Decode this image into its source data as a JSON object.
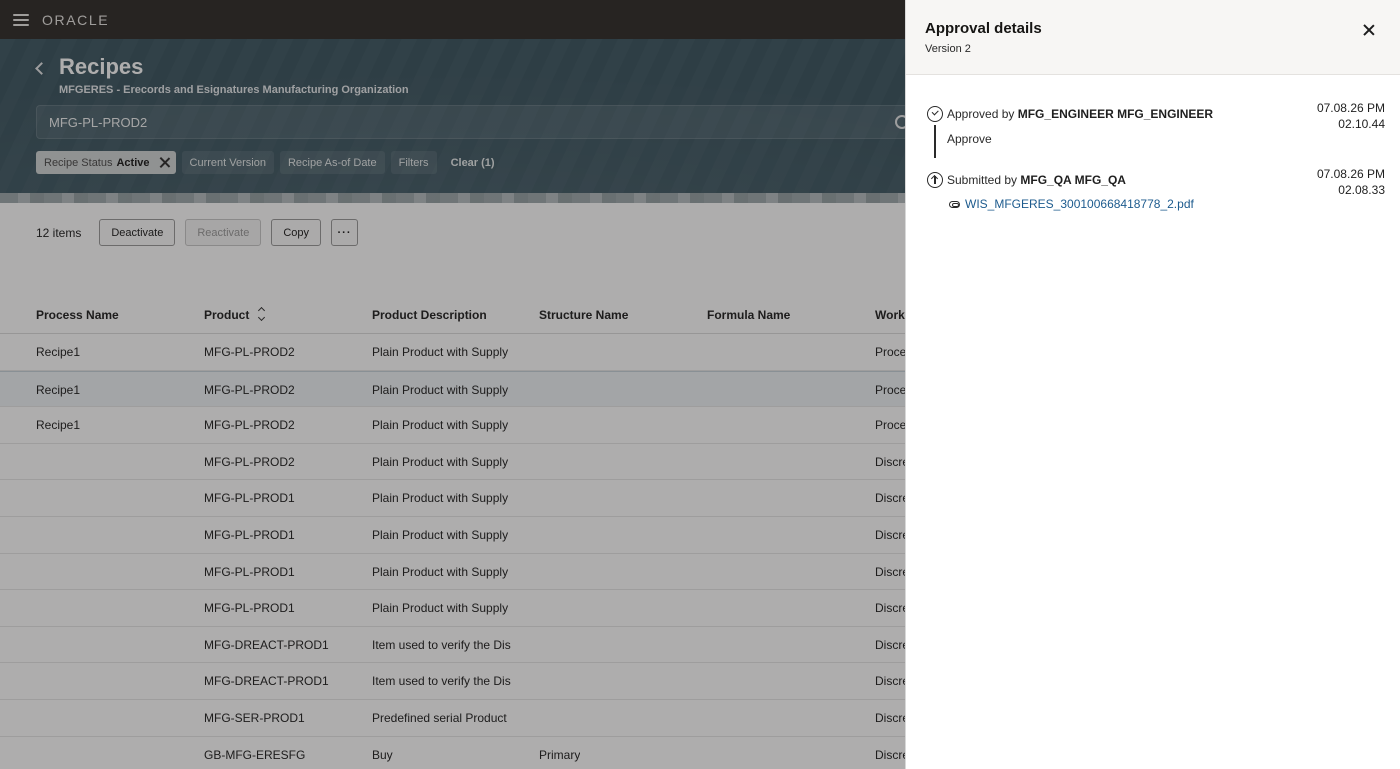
{
  "header": {
    "brand": "ORACLE"
  },
  "page": {
    "title": "Recipes",
    "subtitle": "MFGERES - Erecords and Esignatures Manufacturing Organization",
    "search_value": "MFG-PL-PROD2",
    "filters": {
      "status_key": "Recipe Status",
      "status_value": "Active",
      "current_version": "Current Version",
      "as_of_date": "Recipe As-of Date",
      "filters": "Filters",
      "clear": "Clear (1)"
    }
  },
  "toolbar": {
    "count": "12 items",
    "deactivate": "Deactivate",
    "reactivate": "Reactivate",
    "copy": "Copy",
    "more": "···"
  },
  "table": {
    "columns": [
      "Process Name",
      "Product",
      "Product Description",
      "Structure Name",
      "Formula Name",
      "Work"
    ],
    "rows": [
      {
        "process": "Recipe1",
        "product": "MFG-PL-PROD2",
        "description": "Plain Product with Supply",
        "structure": "",
        "formula": "",
        "work": "Proce"
      },
      {
        "process": "Recipe1",
        "product": "MFG-PL-PROD2",
        "description": "Plain Product with Supply",
        "structure": "",
        "formula": "",
        "work": "Proce"
      },
      {
        "process": "Recipe1",
        "product": "MFG-PL-PROD2",
        "description": "Plain Product with Supply",
        "structure": "",
        "formula": "",
        "work": "Proce"
      },
      {
        "process": "",
        "product": "MFG-PL-PROD2",
        "description": "Plain Product with Supply",
        "structure": "",
        "formula": "",
        "work": "Discre"
      },
      {
        "process": "",
        "product": "MFG-PL-PROD1",
        "description": "Plain Product with Supply",
        "structure": "",
        "formula": "",
        "work": "Discre"
      },
      {
        "process": "",
        "product": "MFG-PL-PROD1",
        "description": "Plain Product with Supply",
        "structure": "",
        "formula": "",
        "work": "Discre"
      },
      {
        "process": "",
        "product": "MFG-PL-PROD1",
        "description": "Plain Product with Supply",
        "structure": "",
        "formula": "",
        "work": "Discre"
      },
      {
        "process": "",
        "product": "MFG-PL-PROD1",
        "description": "Plain Product with Supply",
        "structure": "",
        "formula": "",
        "work": "Discre"
      },
      {
        "process": "",
        "product": "MFG-DREACT-PROD1",
        "description": "Item used to verify the Dis",
        "structure": "",
        "formula": "",
        "work": "Discre"
      },
      {
        "process": "",
        "product": "MFG-DREACT-PROD1",
        "description": "Item used to verify the Dis",
        "structure": "",
        "formula": "",
        "work": "Discre"
      },
      {
        "process": "",
        "product": "MFG-SER-PROD1",
        "description": "Predefined serial Product",
        "structure": "",
        "formula": "",
        "work": "Discre"
      },
      {
        "process": "",
        "product": "GB-MFG-ERESFG",
        "description": "Buy",
        "structure": "Primary",
        "formula": "",
        "work": "Discre"
      }
    ],
    "selected_row_index": 1
  },
  "drawer": {
    "title": "Approval details",
    "subtitle": "Version 2",
    "events": [
      {
        "icon": "check-circle-icon",
        "action": "Approved by",
        "actor": "MFG_ENGINEER MFG_ENGINEER",
        "comment": "Approve",
        "date": "07.08.26 PM",
        "time": "02.10.44"
      },
      {
        "icon": "upload-circle-icon",
        "action": "Submitted by",
        "actor": "MFG_QA MFG_QA",
        "attachment": "WIS_MFGERES_300100668418778_2.pdf",
        "date": "07.08.26 PM",
        "time": "02.08.33"
      }
    ]
  }
}
